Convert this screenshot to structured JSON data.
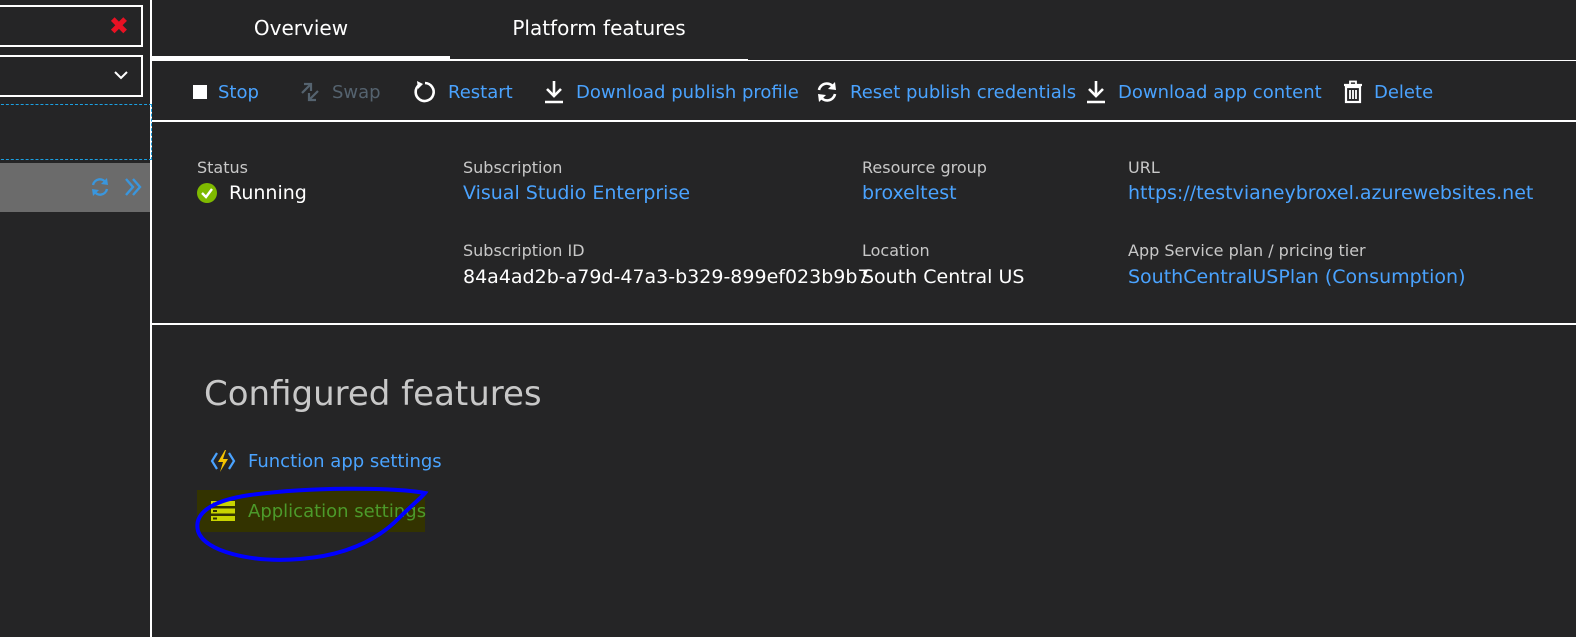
{
  "tabs": [
    {
      "label": "Overview",
      "active": true
    },
    {
      "label": "Platform features",
      "active": false
    }
  ],
  "toolbar": {
    "stop": "Stop",
    "swap": "Swap",
    "restart": "Restart",
    "download_publish_profile": "Download publish profile",
    "reset_publish_credentials": "Reset publish credentials",
    "download_app_content": "Download app content",
    "delete": "Delete"
  },
  "essentials": {
    "status_label": "Status",
    "status_value": "Running",
    "subscription_label": "Subscription",
    "subscription_value": "Visual Studio Enterprise",
    "resource_group_label": "Resource group",
    "resource_group_value": "broxeltest",
    "url_label": "URL",
    "url_value": "https://testvianeybroxel.azurewebsites.net",
    "subscription_id_label": "Subscription ID",
    "subscription_id_value": "84a4ad2b-a79d-47a3-b329-899ef023b9b7",
    "location_label": "Location",
    "location_value": "South Central US",
    "plan_label": "App Service plan / pricing tier",
    "plan_value": "SouthCentralUSPlan (Consumption)"
  },
  "features": {
    "title": "Configured features",
    "items": [
      {
        "label": "Function app settings",
        "icon": "function-bolt-icon"
      },
      {
        "label": "Application settings",
        "icon": "app-settings-icon",
        "highlighted": true
      }
    ]
  },
  "colors": {
    "background": "#252526",
    "link": "#4aa3ff",
    "status_ok": "#7fba00",
    "close_red": "#e81123",
    "annotation": "#0000ff",
    "highlight_text": "#4c9a2a"
  }
}
